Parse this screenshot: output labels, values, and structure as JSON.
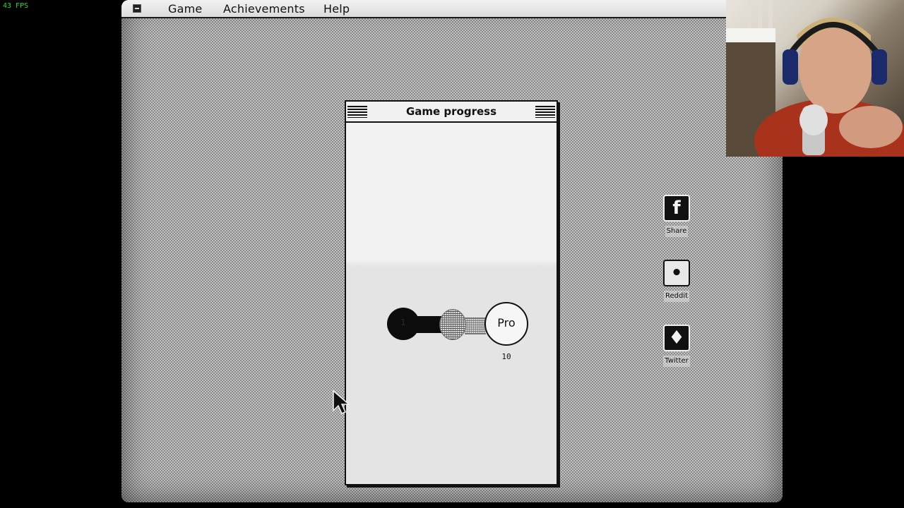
{
  "overlay": {
    "fps": "43 FPS"
  },
  "menubar": {
    "items": [
      {
        "label": "Game"
      },
      {
        "label": "Achievements"
      },
      {
        "label": "Help"
      }
    ]
  },
  "window": {
    "title": "Game progress",
    "progress": {
      "current_level_label": "1",
      "next_level_label": "Pro",
      "next_level_count": "10",
      "fill_fraction": 0.4
    }
  },
  "desktop_icons": [
    {
      "name": "facebook-icon",
      "glyph": "f",
      "label": "Share"
    },
    {
      "name": "reddit-icon",
      "glyph": "•",
      "label": "Reddit"
    },
    {
      "name": "twitter-icon",
      "glyph": "♦",
      "label": "Twitter"
    }
  ],
  "colors": {
    "fps_text": "#2bd82b",
    "window_bg": "#e6e6e6",
    "frame": "#111111"
  }
}
